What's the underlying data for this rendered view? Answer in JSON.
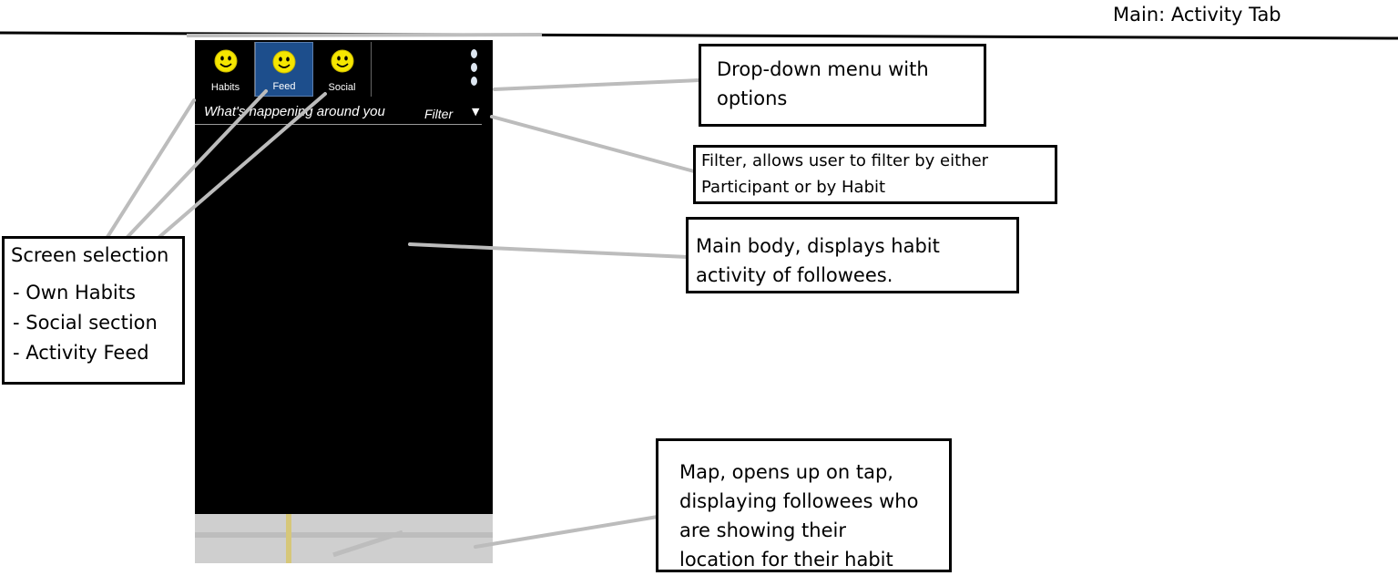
{
  "page_title": "Main: Activity Tab",
  "app": {
    "tabs": [
      {
        "label": "Habits",
        "icon": "smiley-icon",
        "active": false
      },
      {
        "label": "Feed",
        "icon": "smiley-icon",
        "active": true
      },
      {
        "label": "Social",
        "icon": "smiley-icon",
        "active": false
      }
    ],
    "overflow_menu_icon": "vertical-dots-icon",
    "tagline": "What's happening around you",
    "filter_label": "Filter",
    "filter_caret": "▼",
    "colors": {
      "active_tab": "#1d4e8c",
      "background": "#000000",
      "smiley": "#f5e600",
      "map": "#cfcfcf"
    }
  },
  "annotations": {
    "dropdown_menu": {
      "line1": "Drop-down menu with",
      "line2": "options"
    },
    "filter": {
      "line1": "Filter, allows user to filter by either",
      "line2": "Participant or by Habit"
    },
    "main_body": {
      "line1": "Main body, displays habit",
      "line2": "activity of followees."
    },
    "screen_selection": {
      "title": "Screen selection",
      "items": [
        "- Own Habits",
        "- Social section",
        "- Activity Feed"
      ]
    },
    "map": {
      "line1": "Map, opens up on tap,",
      "line2": "displaying followees who",
      "line3": "are showing their",
      "line4": "location for their habit"
    }
  }
}
